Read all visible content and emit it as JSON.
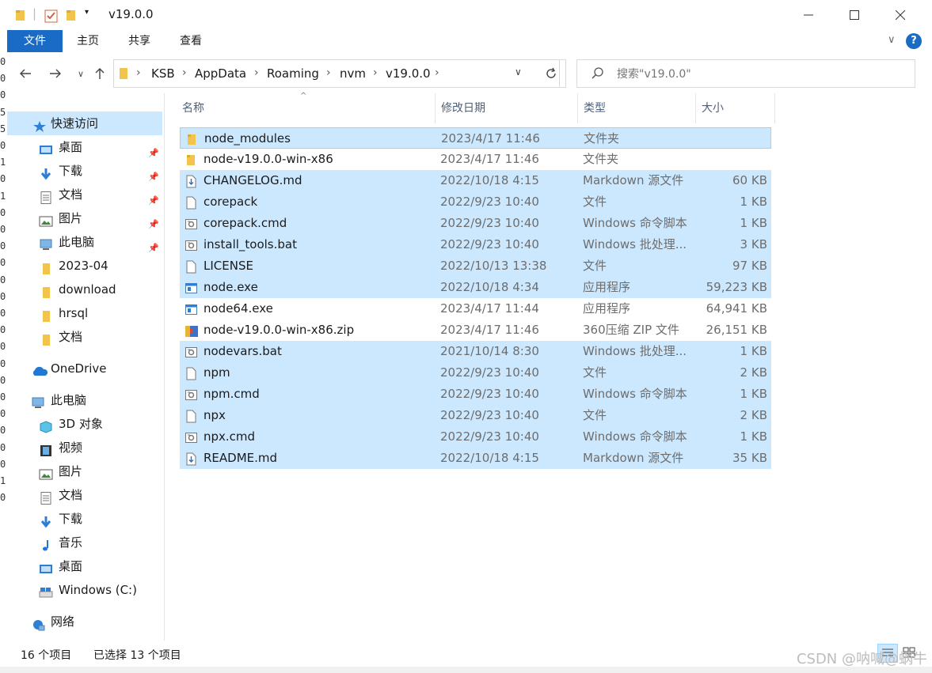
{
  "window": {
    "title": "v19.0.0"
  },
  "background_strip": {
    "digits": [
      "0",
      "0",
      "0",
      "5",
      "5",
      "0",
      "1",
      "0",
      "1",
      "0",
      "0",
      "0",
      "0",
      "0",
      "0",
      "0",
      "0",
      "0",
      "0",
      "0",
      "0",
      "0",
      "0",
      "0",
      "0",
      "1",
      "0"
    ]
  },
  "ribbon": {
    "tabs": [
      "文件",
      "主页",
      "共享",
      "查看"
    ]
  },
  "address": {
    "crumbs": [
      "KSB",
      "AppData",
      "Roaming",
      "nvm",
      "v19.0.0"
    ]
  },
  "search": {
    "placeholder": "搜索\"v19.0.0\""
  },
  "nav": {
    "quick_access": "快速访问",
    "pinned": [
      "桌面",
      "下载",
      "文档",
      "图片",
      "此电脑"
    ],
    "folders": [
      "2023-04",
      "download",
      "hrsql",
      "文档"
    ],
    "onedrive": "OneDrive",
    "this_pc": "此电脑",
    "pc_items": [
      "3D 对象",
      "视频",
      "图片",
      "文档",
      "下载",
      "音乐",
      "桌面",
      "Windows (C:)"
    ],
    "network": "网络"
  },
  "columns": {
    "name": "名称",
    "date": "修改日期",
    "type": "类型",
    "size": "大小"
  },
  "files": [
    {
      "name": "node_modules",
      "date": "2023/4/17 11:46",
      "type": "文件夹",
      "size": "",
      "icon": "folder",
      "selected": true
    },
    {
      "name": "node-v19.0.0-win-x86",
      "date": "2023/4/17 11:46",
      "type": "文件夹",
      "size": "",
      "icon": "folder",
      "selected": false
    },
    {
      "name": "CHANGELOG.md",
      "date": "2022/10/18 4:15",
      "type": "Markdown 源文件",
      "size": "60 KB",
      "icon": "md",
      "selected": true
    },
    {
      "name": "corepack",
      "date": "2022/9/23 10:40",
      "type": "文件",
      "size": "1 KB",
      "icon": "file",
      "selected": true
    },
    {
      "name": "corepack.cmd",
      "date": "2022/9/23 10:40",
      "type": "Windows 命令脚本",
      "size": "1 KB",
      "icon": "script",
      "selected": true
    },
    {
      "name": "install_tools.bat",
      "date": "2022/9/23 10:40",
      "type": "Windows 批处理...",
      "size": "3 KB",
      "icon": "script",
      "selected": true
    },
    {
      "name": "LICENSE",
      "date": "2022/10/13 13:38",
      "type": "文件",
      "size": "97 KB",
      "icon": "file",
      "selected": true
    },
    {
      "name": "node.exe",
      "date": "2022/10/18 4:34",
      "type": "应用程序",
      "size": "59,223 KB",
      "icon": "exe",
      "selected": true
    },
    {
      "name": "node64.exe",
      "date": "2023/4/17 11:44",
      "type": "应用程序",
      "size": "64,941 KB",
      "icon": "exe",
      "selected": false
    },
    {
      "name": "node-v19.0.0-win-x86.zip",
      "date": "2023/4/17 11:46",
      "type": "360压缩 ZIP 文件",
      "size": "26,151 KB",
      "icon": "zip",
      "selected": false
    },
    {
      "name": "nodevars.bat",
      "date": "2021/10/14 8:30",
      "type": "Windows 批处理...",
      "size": "1 KB",
      "icon": "script",
      "selected": true
    },
    {
      "name": "npm",
      "date": "2022/9/23 10:40",
      "type": "文件",
      "size": "2 KB",
      "icon": "file",
      "selected": true
    },
    {
      "name": "npm.cmd",
      "date": "2022/9/23 10:40",
      "type": "Windows 命令脚本",
      "size": "1 KB",
      "icon": "script",
      "selected": true
    },
    {
      "name": "npx",
      "date": "2022/9/23 10:40",
      "type": "文件",
      "size": "2 KB",
      "icon": "file",
      "selected": true
    },
    {
      "name": "npx.cmd",
      "date": "2022/9/23 10:40",
      "type": "Windows 命令脚本",
      "size": "1 KB",
      "icon": "script",
      "selected": true
    },
    {
      "name": "README.md",
      "date": "2022/10/18 4:15",
      "type": "Markdown 源文件",
      "size": "35 KB",
      "icon": "md",
      "selected": true
    }
  ],
  "status": {
    "count": "16 个项目",
    "selected": "已选择 13 个项目"
  },
  "watermark": "CSDN @呐喊@蜗牛"
}
